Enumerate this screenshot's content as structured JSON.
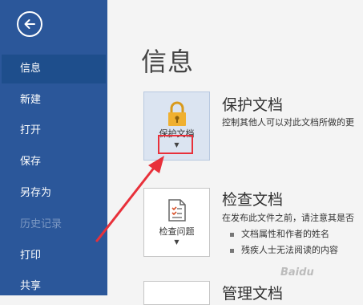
{
  "sidebar": {
    "back_icon": "back-arrow-icon",
    "items": [
      {
        "label": "信息",
        "state": "active"
      },
      {
        "label": "新建",
        "state": "normal"
      },
      {
        "label": "打开",
        "state": "normal"
      },
      {
        "label": "保存",
        "state": "normal"
      },
      {
        "label": "另存为",
        "state": "normal"
      },
      {
        "label": "历史记录",
        "state": "disabled"
      },
      {
        "label": "打印",
        "state": "normal"
      },
      {
        "label": "共享",
        "state": "normal"
      }
    ],
    "colors": {
      "background": "#2b579a",
      "active": "#1e4e8c"
    }
  },
  "main": {
    "title": "信息",
    "protect": {
      "button_label": "保护文档",
      "title": "保护文档",
      "description": "控制其他人可以对此文档所做的更",
      "icon": "lock-key-icon"
    },
    "inspect": {
      "button_label": "检查问题",
      "title": "检查文档",
      "description": "在发布此文件之前，请注意其是否",
      "bullets": [
        "文档属性和作者的姓名",
        "残疾人士无法阅读的内容"
      ],
      "icon": "checklist-icon"
    },
    "manage": {
      "title": "管理文档"
    }
  },
  "watermark": "Baidu",
  "annotation_color": "#e8303a"
}
